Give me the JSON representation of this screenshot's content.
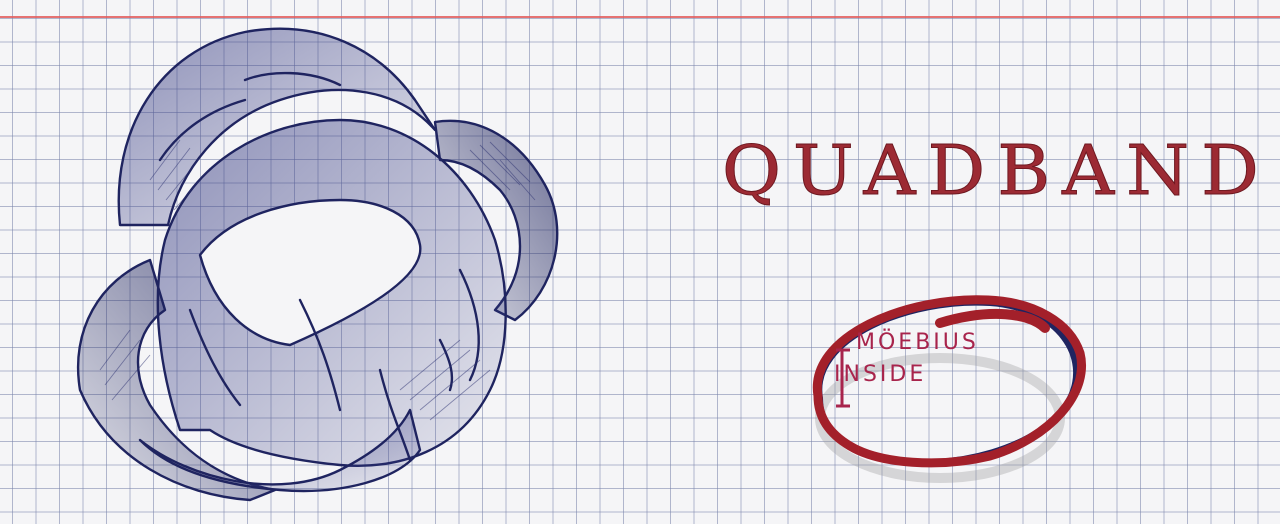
{
  "title": "QUADBAND",
  "logo": {
    "line1": "MÖEBIUS",
    "line2": "INSIDE"
  },
  "colors": {
    "paper": "#f5f5f7",
    "grid": "#7882aa",
    "margin_line": "#e25b5b",
    "ink_blue": "#1f2460",
    "ink_red": "#9c2a33",
    "logo_text": "#a8244c"
  }
}
